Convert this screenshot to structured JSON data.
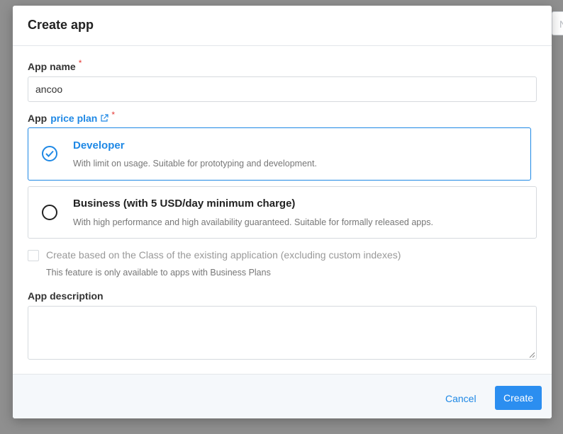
{
  "background": {
    "partial_field_text": "N"
  },
  "modal": {
    "title": "Create app",
    "app_name": {
      "label": "App name",
      "required": "*",
      "value": "ancoo"
    },
    "price_plan": {
      "label_prefix": "App",
      "link_text": "price plan",
      "required": "*",
      "options": [
        {
          "title": "Developer",
          "description": "With limit on usage. Suitable for prototyping and development.",
          "selected": true
        },
        {
          "title": "Business (with 5 USD/day minimum charge)",
          "description": "With high performance and high availability guaranteed. Suitable for formally released apps.",
          "selected": false
        }
      ]
    },
    "clone_option": {
      "label": "Create based on the Class of the existing application (excluding custom indexes)",
      "help": "This feature is only available to apps with Business Plans",
      "checked": false,
      "disabled": true
    },
    "app_description": {
      "label": "App description",
      "value": ""
    },
    "footer": {
      "cancel_label": "Cancel",
      "create_label": "Create"
    }
  },
  "colors": {
    "accent": "#1e88e5",
    "required": "#e53935",
    "primary_button": "#2b8ef0"
  }
}
